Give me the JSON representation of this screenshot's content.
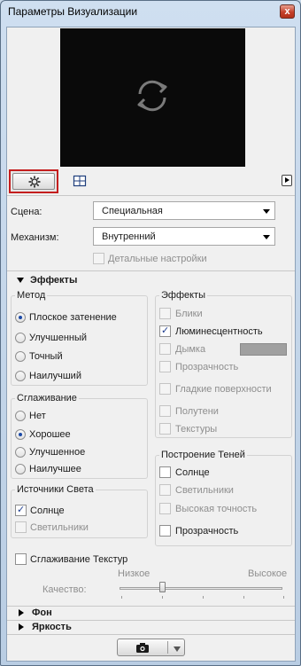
{
  "window": {
    "title": "Параметры Визуализации",
    "close_label": "x"
  },
  "preview": {
    "icon": "refresh-icon",
    "background": "#0a0a0a"
  },
  "toolbar": {
    "settings_icon": "gear-icon",
    "crop_icon": "crop-icon",
    "expand_icon": "arrow-right-icon"
  },
  "scene": {
    "label": "Сцена:",
    "value": "Специальная"
  },
  "engine": {
    "label": "Механизм:",
    "value": "Внутренний"
  },
  "detailed_settings": {
    "label": "Детальные настройки",
    "checked": false,
    "enabled": false
  },
  "effects_section": {
    "title": "Эффекты"
  },
  "method": {
    "title": "Метод",
    "options": [
      {
        "label": "Плоское затенение",
        "selected": true
      },
      {
        "label": "Улучшенный",
        "selected": false
      },
      {
        "label": "Точный",
        "selected": false
      },
      {
        "label": "Наилучший",
        "selected": false
      }
    ]
  },
  "antialiasing": {
    "title": "Сглаживание",
    "options": [
      {
        "label": "Нет",
        "selected": false
      },
      {
        "label": "Хорошее",
        "selected": true
      },
      {
        "label": "Улучшенное",
        "selected": false
      },
      {
        "label": "Наилучшее",
        "selected": false
      }
    ]
  },
  "light_sources": {
    "title": "Источники Света",
    "items": [
      {
        "label": "Солнце",
        "checked": true,
        "enabled": true
      },
      {
        "label": "Светильники",
        "checked": false,
        "enabled": false
      }
    ]
  },
  "effects": {
    "title": "Эффекты",
    "items": [
      {
        "label": "Блики",
        "checked": false,
        "enabled": false
      },
      {
        "label": "Люминесцентность",
        "checked": true,
        "enabled": true
      },
      {
        "label": "Дымка",
        "checked": false,
        "enabled": false
      },
      {
        "label": "Прозрачность",
        "checked": false,
        "enabled": false
      },
      {
        "label": "Гладкие поверхности",
        "checked": false,
        "enabled": true
      },
      {
        "label": "Полутени",
        "checked": false,
        "enabled": false
      },
      {
        "label": "Текстуры",
        "checked": false,
        "enabled": false
      }
    ],
    "haze_color": "#a0a0a0"
  },
  "shadows": {
    "title": "Построение Теней",
    "items": [
      {
        "label": "Солнце",
        "checked": false,
        "enabled": true
      },
      {
        "label": "Светильники",
        "checked": false,
        "enabled": false
      },
      {
        "label": "Высокая точность",
        "checked": false,
        "enabled": false
      },
      {
        "label": "Прозрачность",
        "checked": false,
        "enabled": true
      }
    ]
  },
  "texture_smoothing": {
    "label": "Сглаживание Текстур",
    "checked": false,
    "quality_label": "Качество:",
    "low_label": "Низкое",
    "high_label": "Высокое",
    "value": 0.25
  },
  "collapsed_sections": [
    {
      "title": "Фон"
    },
    {
      "title": "Яркость"
    }
  ],
  "bottom": {
    "camera_icon": "camera-icon",
    "menu_icon": "chevron-down-icon"
  }
}
